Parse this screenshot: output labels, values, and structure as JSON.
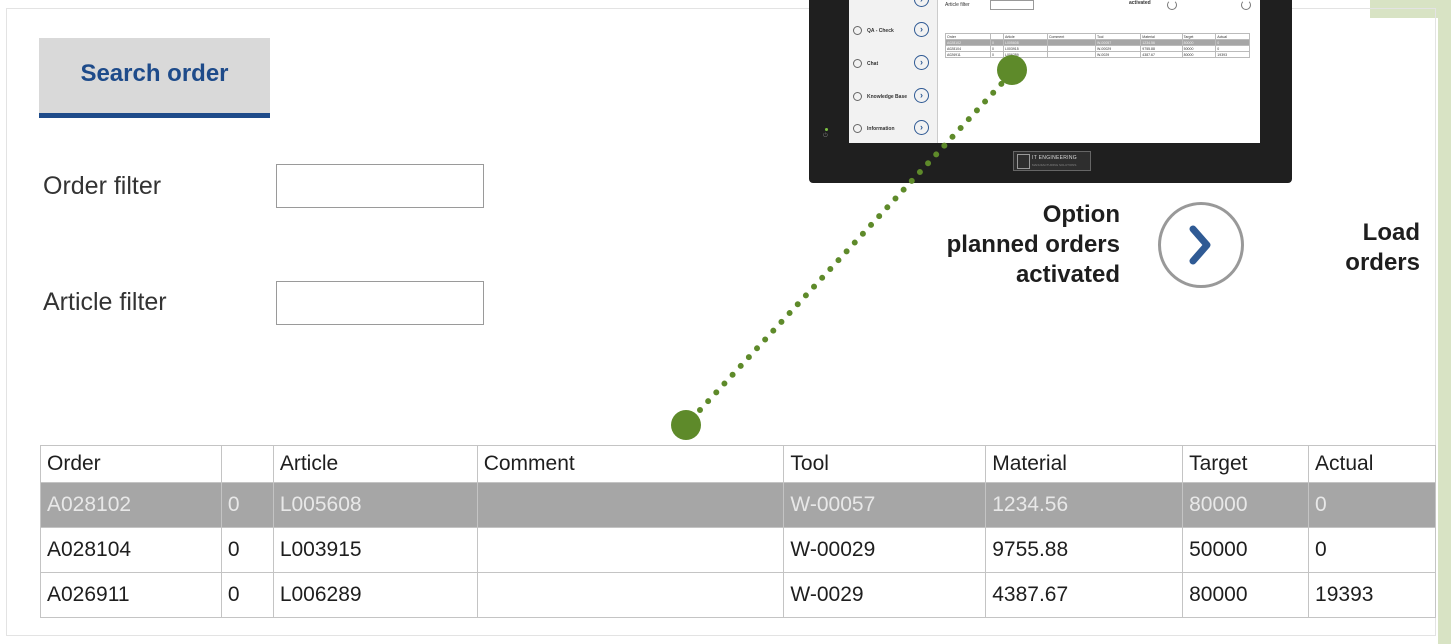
{
  "tab": {
    "label": "Search order"
  },
  "filters": {
    "order_label": "Order filter",
    "order_value": "",
    "article_label": "Article filter",
    "article_value": ""
  },
  "option": {
    "line1": "Option",
    "line2": "planned orders",
    "line3": "activated"
  },
  "load": {
    "line1": "Load",
    "line2": "orders",
    "icon": "chevron-right-icon"
  },
  "table": {
    "headers": [
      "Order",
      "",
      "Article",
      "Comment",
      "Tool",
      "Material",
      "Target",
      "Actual"
    ],
    "rows": [
      [
        "A028102",
        "0",
        "L005608",
        "",
        "W-00057",
        "1234.56",
        "80000",
        "0"
      ],
      [
        "A028104",
        "0",
        "L003915",
        "",
        "W-00029",
        "9755.88",
        "50000",
        "0"
      ],
      [
        "A026911",
        "0",
        "L006289",
        "",
        "W-0029",
        "4387.67",
        "80000",
        "19393"
      ]
    ],
    "selected_row": 0
  },
  "device": {
    "nav_items": [
      "QA - Check",
      "Chat",
      "Knowledge Base",
      "Information"
    ],
    "filter_label": "Article filter",
    "activated_label": "activated",
    "logo_text": "IT ENGINEERING",
    "logo_sub": "MANUFACTURING SOLUTIONS",
    "mini_headers": [
      "Order",
      "",
      "Article",
      "Comment",
      "Tool",
      "Material",
      "Target",
      "Actual"
    ],
    "mini_rows": [
      [
        "A028102",
        "0",
        "L005608",
        "",
        "W-00057",
        "1234.56",
        "80000",
        "0"
      ],
      [
        "A028104",
        "0",
        "L003915",
        "",
        "W-00029",
        "9755.88",
        "50000",
        "0"
      ],
      [
        "A026911",
        "0",
        "L006289",
        "",
        "W-0029",
        "4387.67",
        "80000",
        "19393"
      ]
    ]
  },
  "colors": {
    "accent": "#1e4b8a",
    "tab_bg": "#d9d9d9",
    "selected_row": "#a6a6a6",
    "connector": "#5e8a2a"
  }
}
